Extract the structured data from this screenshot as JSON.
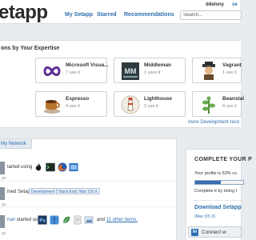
{
  "header": {
    "logo": "etapp",
    "nav": [
      "My Setapp",
      "Starred",
      "Recommendations"
    ],
    "username": "ddelony",
    "username_more": "se",
    "search_placeholder": "Search..."
  },
  "expertise": {
    "title": "ons by Your Expertise",
    "apps": [
      {
        "name": "Microsoft Visua...",
        "uses": "7 use it",
        "icon": "visual-studio-icon"
      },
      {
        "name": "Middleman",
        "uses": "1 uses it",
        "icon": "middleman-icon"
      },
      {
        "name": "Vagrant",
        "uses": "1 use it",
        "icon": "vagrant-icon"
      },
      {
        "name": "Espresso",
        "uses": "4 use it",
        "icon": "espresso-icon"
      },
      {
        "name": "Lighthouse",
        "uses": "3 use it",
        "icon": "lighthouse-icon"
      },
      {
        "name": "Beanstal",
        "uses": "4 use it",
        "icon": "beanstalk-icon"
      }
    ],
    "more_link": "more Development reco"
  },
  "network": {
    "tab": "My Network",
    "feed": [
      {
        "text": "tarted using",
        "time": "go"
      },
      {
        "text": "ined Setapp",
        "tags": [
          "Development",
          "Back End",
          "Mac OS X"
        ],
        "time": "go"
      },
      {
        "text_link": "nan",
        "text": " started using",
        "and_text": "and",
        "more_link": "11 other items.",
        "time": "go"
      }
    ]
  },
  "profile": {
    "title": "COMPLETE YOUR P",
    "text": "Your profile is 53% co",
    "progress": 0.53,
    "text2": "Complete it by doing t",
    "download": "Download Setapp",
    "download_sub": "(Mac OS X)",
    "linkedin": "Connect w",
    "linkedin_badge": "in"
  }
}
